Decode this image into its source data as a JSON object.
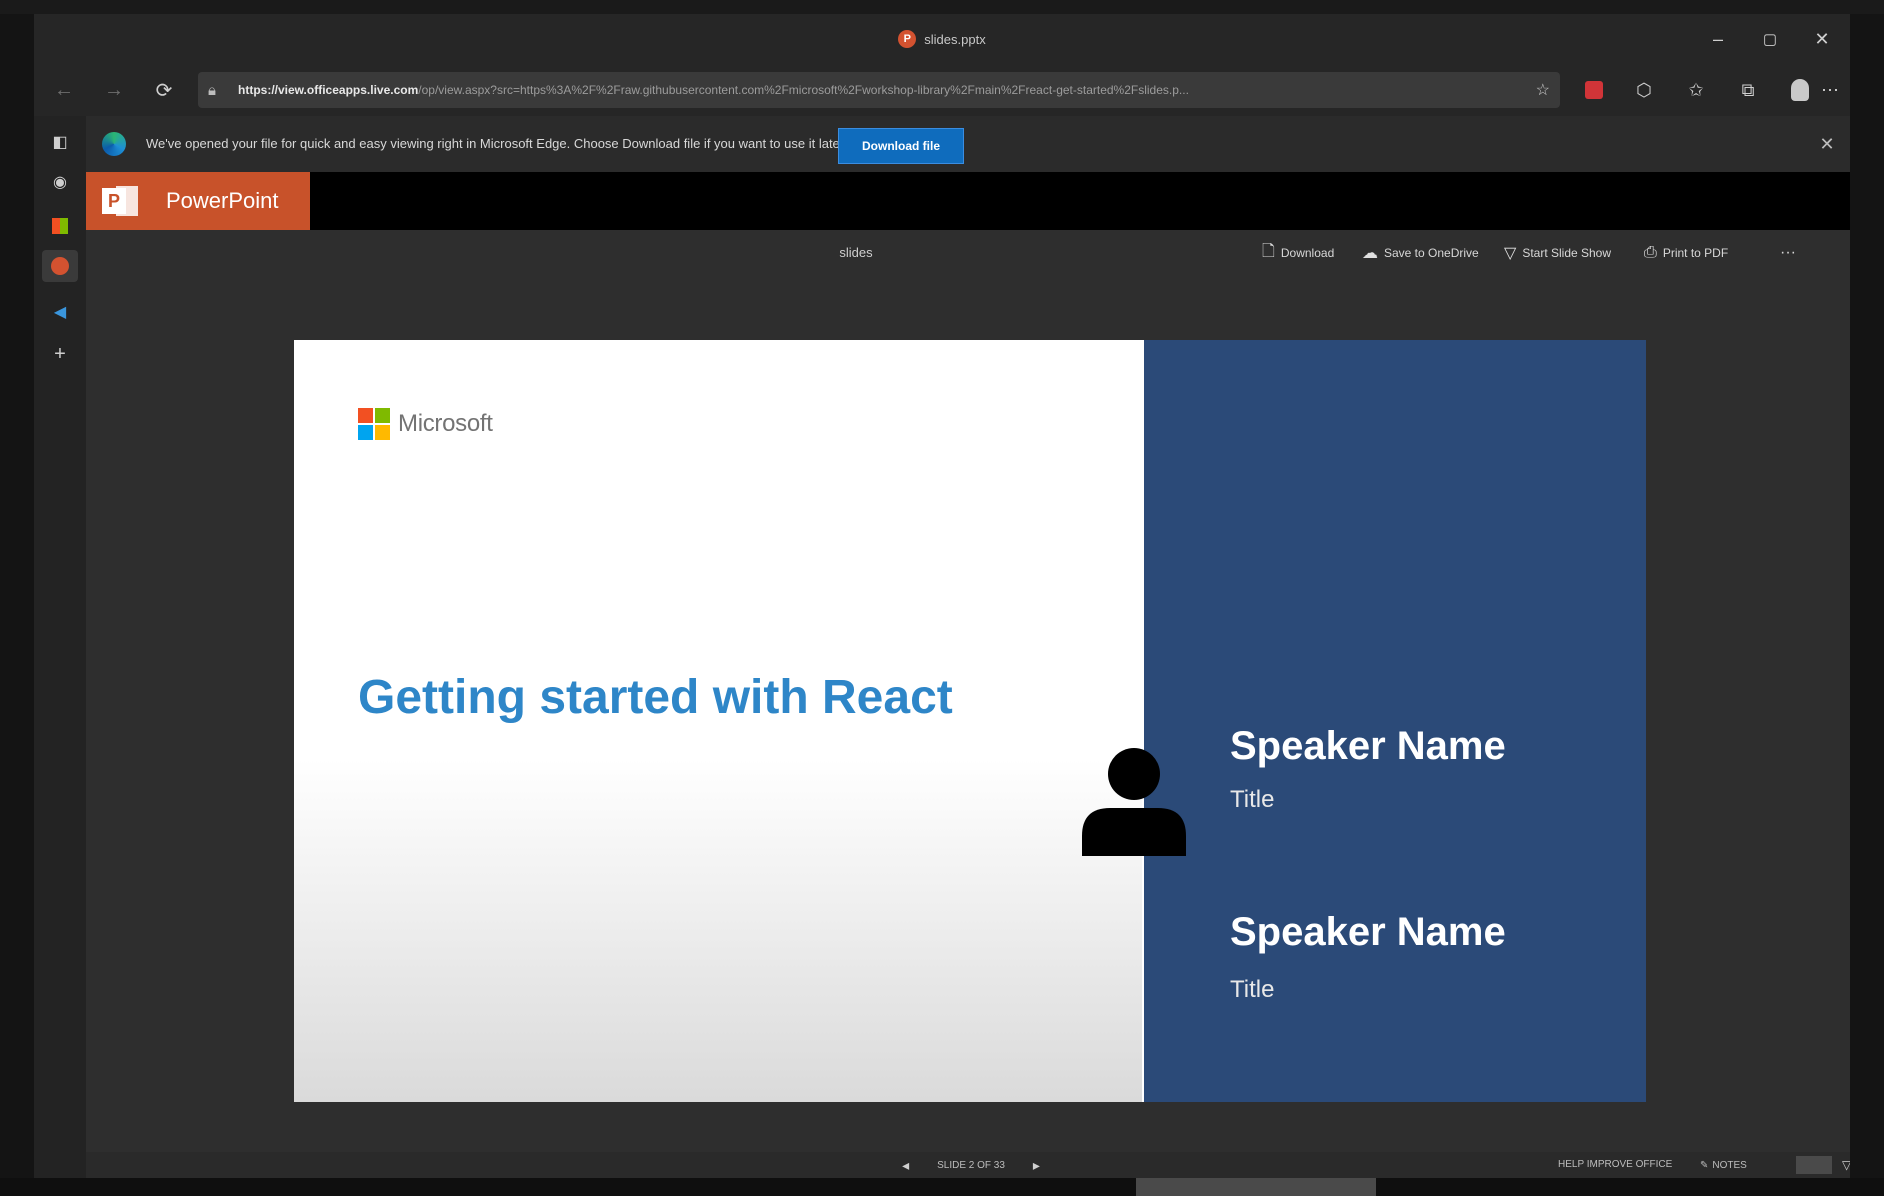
{
  "browser": {
    "tab_title": "slides.pptx",
    "url_host": "https://view.officeapps.live.com",
    "url_path": "/op/view.aspx?src=https%3A%2F%2Fraw.githubusercontent.com%2Fmicrosoft%2Fworkshop-library%2Fmain%2Freact-get-started%2Fslides.p...",
    "window_controls": {
      "minimize": "–",
      "restore": "▢",
      "close": "✕"
    },
    "nav": {
      "back": "←",
      "forward": "→",
      "refresh": "⟳"
    },
    "icons": [
      "lock-icon",
      "favorite-add-icon",
      "pdf-extension-icon",
      "extension-icon",
      "favorites-icon",
      "collections-icon",
      "profile-icon",
      "more-icon"
    ]
  },
  "infobar": {
    "message": "We've opened your file for quick and easy viewing right in Microsoft Edge. Choose Download file if you want to use it later.",
    "button": "Download file",
    "close": "✕"
  },
  "office": {
    "app_name": "PowerPoint",
    "doc_name": "slides",
    "commands": {
      "download": "Download",
      "save_onedrive": "Save to OneDrive",
      "start_slideshow": "Start Slide Show",
      "print_pdf": "Print to PDF",
      "more": "···"
    }
  },
  "slide": {
    "brand": "Microsoft",
    "title": "Getting started with React",
    "speakers": [
      {
        "name": "Speaker Name",
        "title": "Title"
      },
      {
        "name": "Speaker Name",
        "title": "Title"
      }
    ],
    "colors": {
      "accent": "#2e86c8",
      "panel": "#2b4a78",
      "ms_red": "#f25022",
      "ms_green": "#7fba00",
      "ms_blue": "#00a4ef",
      "ms_yellow": "#ffb900"
    }
  },
  "statusbar": {
    "prev": "◂",
    "position": "SLIDE 2 OF 33",
    "next": "▸",
    "help": "HELP IMPROVE OFFICE",
    "notes": "NOTES"
  }
}
